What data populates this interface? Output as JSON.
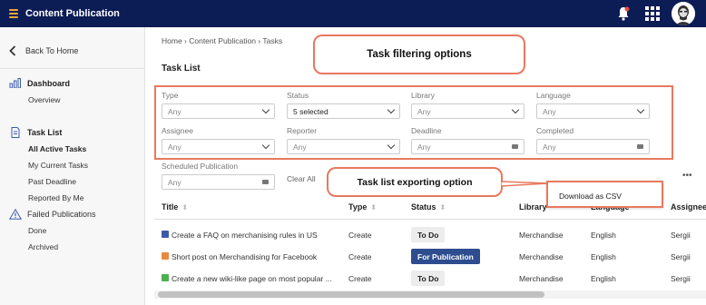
{
  "app": {
    "title": "Content Publication"
  },
  "sidebar": {
    "back_label": "Back To Home",
    "dashboard": {
      "label": "Dashboard",
      "items": [
        "Overview"
      ]
    },
    "tasklist": {
      "label": "Task List",
      "items": [
        "All Active Tasks",
        "My Current Tasks",
        "Past Deadline",
        "Reported By Me"
      ]
    },
    "failed": {
      "label": "Failed Publications",
      "items": [
        "Done",
        "Archived"
      ]
    }
  },
  "breadcrumb": "Home › Content Publication › Tasks",
  "page_title": "Task List",
  "filters": [
    {
      "label": "Type",
      "value": "Any",
      "kind": "select"
    },
    {
      "label": "Status",
      "value": "5 selected",
      "kind": "select"
    },
    {
      "label": "Library",
      "value": "Any",
      "kind": "select"
    },
    {
      "label": "Language",
      "value": "Any",
      "kind": "select"
    },
    {
      "label": "Assignee",
      "value": "Any",
      "kind": "select"
    },
    {
      "label": "Reporter",
      "value": "Any",
      "kind": "select"
    },
    {
      "label": "Deadline",
      "value": "Any",
      "kind": "date"
    },
    {
      "label": "Completed",
      "value": "Any",
      "kind": "date"
    },
    {
      "label": "Scheduled Publication",
      "value": "Any",
      "kind": "date"
    }
  ],
  "clear_all": "Clear All",
  "more_menu": "•••",
  "callouts": {
    "filtering": "Task filtering options",
    "exporting": "Task list exporting option"
  },
  "dropdown": {
    "download_csv": "Download as CSV"
  },
  "table": {
    "headers": [
      "Title",
      "Type",
      "Status",
      "Library",
      "Language",
      "Assignee"
    ],
    "rows": [
      {
        "title": "Create a FAQ on merchanising rules in US",
        "type": "Create",
        "status": "To Do",
        "library": "Merchandise",
        "language": "English",
        "assignee": "Sergii",
        "icon_color": "#3b5ba9"
      },
      {
        "title": "Short post on Merchandising for Facebook",
        "type": "Create",
        "status": "For Publication",
        "library": "Merchandise",
        "language": "English",
        "assignee": "Sergii",
        "icon_color": "#e9893c"
      },
      {
        "title": "Create a new wiki-like page on most popular ...",
        "type": "Create",
        "status": "To Do",
        "library": "Merchandise",
        "language": "English",
        "assignee": "Sergii",
        "icon_color": "#4caf50"
      }
    ]
  },
  "colors": {
    "topbar": "#0c1c55",
    "accent": "#f0a63a",
    "callout_border": "#e8785e",
    "badge_publication": "#2e4d8f"
  }
}
